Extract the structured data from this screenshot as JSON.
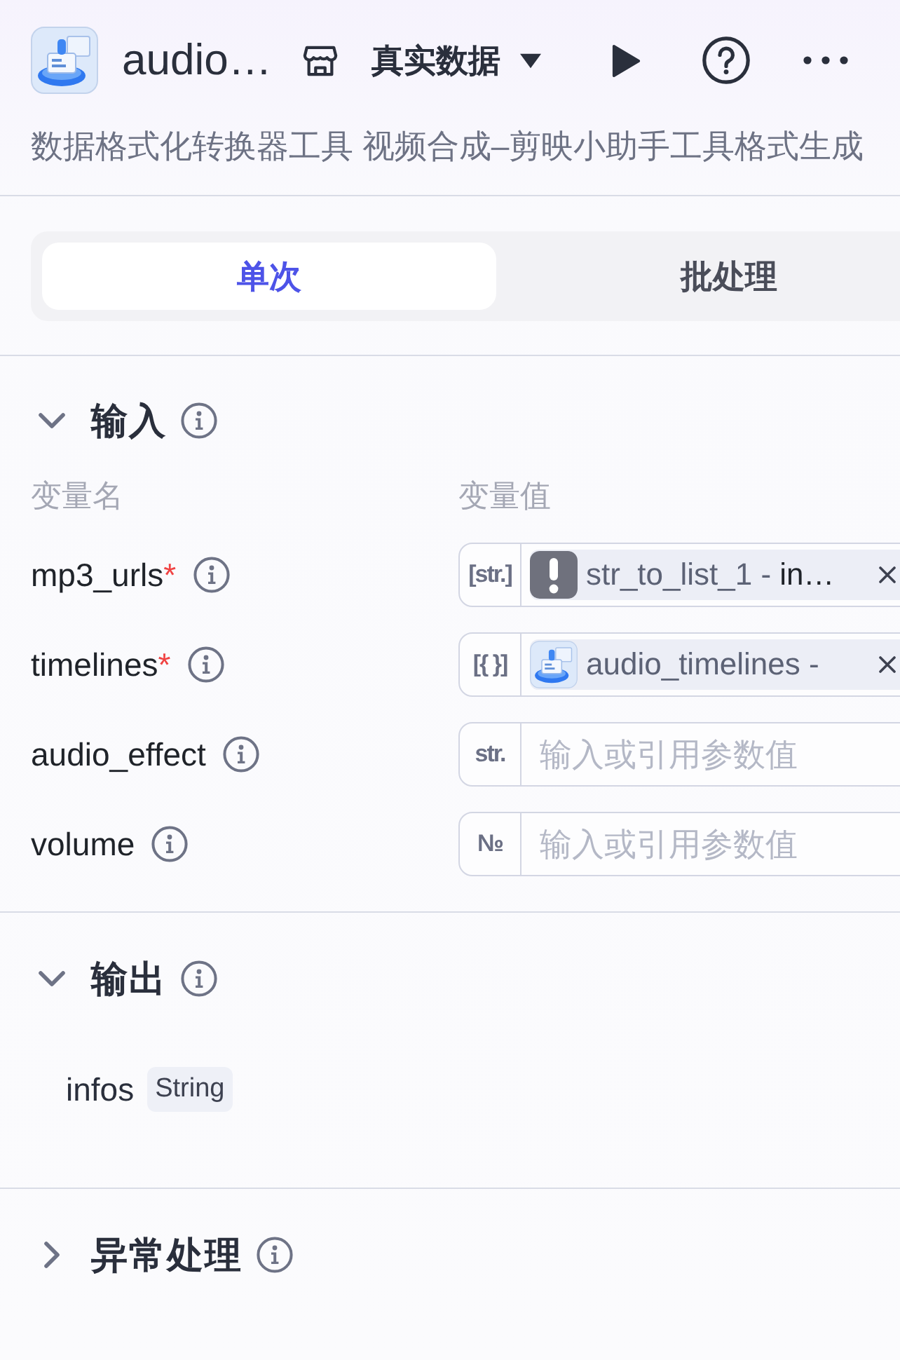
{
  "header": {
    "title": "audio…",
    "data_source": "真实数据",
    "description": "数据格式化转换器工具 视频合成–剪映小助手工具格式生成"
  },
  "tabs": [
    {
      "label": "单次",
      "selected": true
    },
    {
      "label": "批处理",
      "selected": false
    }
  ],
  "sections": [
    {
      "kind": "inputs",
      "title": "输入",
      "expanded": true,
      "columns": [
        "变量名",
        "变量值"
      ],
      "rows": [
        {
          "name": "mp3_urls",
          "required_mark": "*",
          "type": "[str.]",
          "value": {
            "kind": "reference",
            "valid": false,
            "node": "str_to_list_1 -",
            "variable": "in…"
          }
        },
        {
          "name": "timelines",
          "required_mark": "*",
          "type": "[{ }]",
          "value": {
            "kind": "reference",
            "valid": true,
            "node": "audio_timelines -"
          }
        },
        {
          "name": "audio_effect",
          "type": "str.",
          "value": {
            "kind": "input",
            "placeholder": "输入或引用参数值"
          }
        },
        {
          "name": "volume",
          "type": "№",
          "value": {
            "kind": "input",
            "placeholder": "输入或引用参数值"
          }
        }
      ]
    },
    {
      "kind": "outputs",
      "title": "输出",
      "expanded": true,
      "fields": [
        {
          "name": "infos",
          "type": "String"
        }
      ]
    },
    {
      "kind": "error_handling",
      "title": "异常处理",
      "expanded": false
    }
  ]
}
